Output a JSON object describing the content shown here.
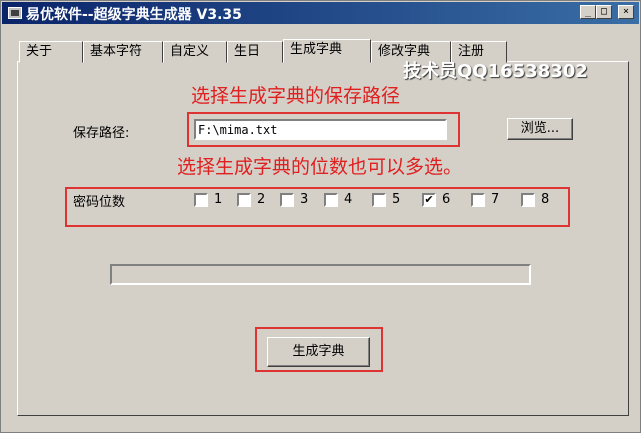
{
  "window": {
    "title": "易优软件--超级字典生成器 V3.35"
  },
  "titlebar_buttons": {
    "minimize": "_",
    "maximize": "□",
    "close": "×"
  },
  "tabs": [
    {
      "label": "关于"
    },
    {
      "label": "基本字符"
    },
    {
      "label": "自定义"
    },
    {
      "label": "生日"
    },
    {
      "label": "生成字典",
      "active": true
    },
    {
      "label": "修改字典"
    },
    {
      "label": "注册"
    }
  ],
  "watermark": "技术员QQ16538302",
  "notes": {
    "save_path_hint": "选择生成字典的保存路径",
    "digits_hint": "选择生成字典的位数也可以多选。"
  },
  "save_path": {
    "label": "保存路径:",
    "value": "F:\\mima.txt",
    "browse_label": "浏览..."
  },
  "digits": {
    "label": "密码位数",
    "options": [
      {
        "label": "1",
        "checked": false,
        "mark": ""
      },
      {
        "label": "2",
        "checked": false,
        "mark": ""
      },
      {
        "label": "3",
        "checked": false,
        "mark": ""
      },
      {
        "label": "4",
        "checked": false,
        "mark": ""
      },
      {
        "label": "5",
        "checked": false,
        "mark": ""
      },
      {
        "label": "6",
        "checked": true,
        "mark": "✔"
      },
      {
        "label": "7",
        "checked": false,
        "mark": ""
      },
      {
        "label": "8",
        "checked": false,
        "mark": ""
      }
    ]
  },
  "progress": {
    "value": 0
  },
  "generate_button": {
    "label": "生成字典"
  },
  "colors": {
    "annotation": "#e02020",
    "titlebar": "#0a246a",
    "face": "#d4d0c8"
  }
}
